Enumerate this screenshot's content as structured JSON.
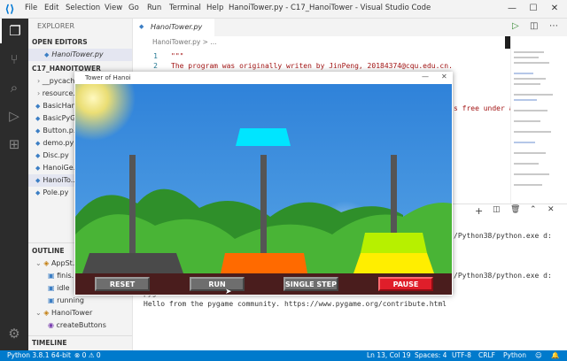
{
  "titlebar": {
    "menus": [
      "File",
      "Edit",
      "Selection",
      "View",
      "Go",
      "Run",
      "Terminal",
      "Help"
    ],
    "title": "HanoiTower.py - C17_HanoiTower - Visual Studio Code",
    "minimize": "—",
    "maximize": "☐",
    "close": "✕"
  },
  "sidebar": {
    "explorer_label": "EXPLORER",
    "open_editors_label": "OPEN EDITORS",
    "open_file": "HanoiTower.py",
    "folder_label": "C17_HANOITOWER",
    "files": [
      "__pycach...",
      "resource...",
      "BasicHan...",
      "BasicPyG...",
      "Button.p...",
      "demo.py",
      "Disc.py",
      "HanoiGe...",
      "HanoiTo...",
      "Pole.py"
    ],
    "outline_label": "OUTLINE",
    "outline_items": [
      "AppSt...",
      "finis...",
      "idle",
      "running",
      "HanoiTower",
      "createButtons"
    ],
    "timeline_label": "TIMELINE"
  },
  "editor": {
    "tab_label": "HanoiTower.py",
    "breadcrumb": "HanoiTower.py > ...",
    "line_numbers": [
      "1",
      "2"
    ],
    "lines": [
      "\"\"\"",
      "The program was originally writen by JinPeng, 20184374@cqu.edu.cn."
    ],
    "overflow_text": "s free under a"
  },
  "terminal": {
    "path1": "/Python38/python.exe d:",
    "path2": "/Python38/python.exe d:",
    "line3": "pygame 2.0.",
    "line4": "Hello from the pygame community. https://www.pygame.org/contribute.html"
  },
  "pygame": {
    "title": "Tower of Hanoi",
    "buttons": {
      "reset": "RESET",
      "run": "RUN",
      "single_step": "SINGLE STEP",
      "pause": "PAUSE"
    },
    "colors": {
      "disc_top": "#00e5ff",
      "disc1": "#4a4a4a",
      "disc2": "#ff6a00",
      "disc3_top": "#b7f000",
      "disc3_bottom": "#ffee00",
      "reset_btn": "#6e6e6e",
      "pause_btn": "#e01e2a",
      "bar": "#4a1d1d"
    }
  },
  "statusbar": {
    "python": "Python 3.8.1 64-bit",
    "problems": "⊗ 0  ⚠ 0",
    "position": "Ln 13, Col 19",
    "spaces": "Spaces: 4",
    "encoding": "UTF-8",
    "eol": "CRLF",
    "language": "Python"
  }
}
